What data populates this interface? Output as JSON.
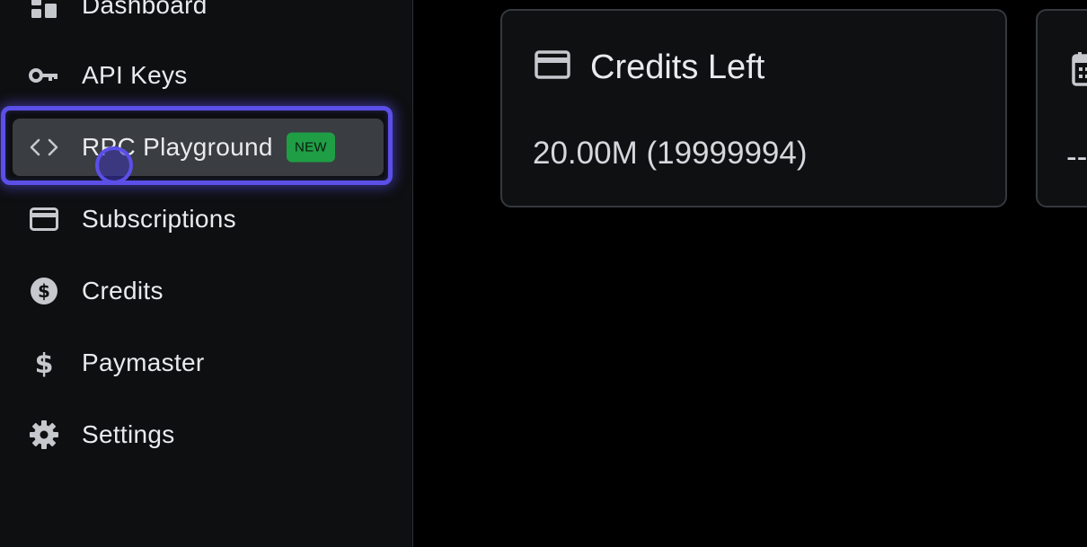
{
  "sidebar": {
    "items": [
      {
        "label": "Dashboard",
        "icon": "dashboard-icon"
      },
      {
        "label": "API Keys",
        "icon": "key-icon"
      },
      {
        "label": "RPC Playground",
        "icon": "code-icon",
        "badge": "NEW",
        "active": true
      },
      {
        "label": "Subscriptions",
        "icon": "credit-card-icon"
      },
      {
        "label": "Credits",
        "icon": "dollar-circle-icon"
      },
      {
        "label": "Paymaster",
        "icon": "dollar-icon"
      },
      {
        "label": "Settings",
        "icon": "gear-icon"
      }
    ]
  },
  "cards": {
    "credits": {
      "title": "Credits Left",
      "value": "20.00M (19999994)",
      "icon": "credit-card-icon"
    },
    "next": {
      "value": "--",
      "icon": "calendar-icon"
    }
  },
  "colors": {
    "accent": "#5b4fe8",
    "badge_bg": "#1f9e45",
    "sidebar_bg": "#0d0f11",
    "card_bg": "#0e1012",
    "active_bg": "#3a3d42"
  }
}
